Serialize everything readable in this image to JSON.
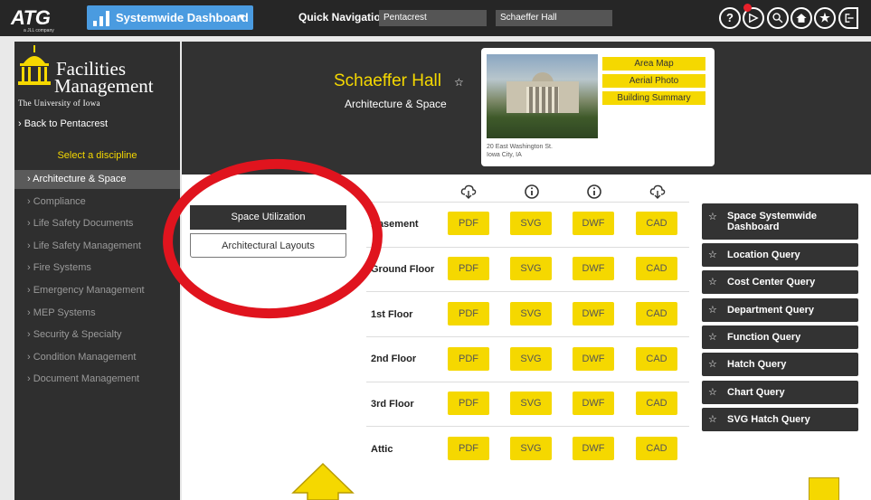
{
  "topbar": {
    "logo": "ATG",
    "logo_sub": "a JLL company",
    "dashboard_label": "Systemwide Dashboard",
    "quick_nav_label": "Quick Navigation",
    "quick_nav_campus": "Pentacrest",
    "quick_nav_building": "Schaeffer Hall",
    "icons": [
      "help-icon",
      "notification-icon",
      "search-icon",
      "home-icon",
      "star-icon",
      "logout-icon"
    ],
    "accent": "#4a9be0"
  },
  "sidebar": {
    "title_line1": "Facilities",
    "title_line2": "Management",
    "university": "The University of Iowa",
    "back_link": "› Back to Pentacrest",
    "select_label": "Select a discipline",
    "items": [
      {
        "label": "› Architecture & Space",
        "active": true
      },
      {
        "label": "› Compliance"
      },
      {
        "label": "› Life Safety Documents"
      },
      {
        "label": "› Life Safety Management"
      },
      {
        "label": "› Fire Systems"
      },
      {
        "label": "› Emergency Management"
      },
      {
        "label": "› MEP Systems"
      },
      {
        "label": "› Security & Specialty"
      },
      {
        "label": "› Condition Management"
      },
      {
        "label": "› Document Management"
      }
    ]
  },
  "header": {
    "building_name": "Schaeffer Hall",
    "discipline": "Architecture & Space",
    "address_line1": "20 East Washington St.",
    "address_line2": "Iowa City, IA",
    "buttons": [
      "Area Map",
      "Aerial Photo",
      "Building Summary"
    ],
    "accent": "#f5d800"
  },
  "tabs": [
    "Space Utilization",
    "Architectural Layouts"
  ],
  "column_icons": [
    "cloud-download-icon",
    "info-icon",
    "info-icon",
    "cloud-download-icon"
  ],
  "file_types": [
    "PDF",
    "SVG",
    "DWF",
    "CAD"
  ],
  "floors": [
    "Basement",
    "Ground Floor",
    "1st Floor",
    "2nd Floor",
    "3rd Floor",
    "Attic"
  ],
  "queries": [
    "Space Systemwide Dashboard",
    "Location Query",
    "Cost Center Query",
    "Department Query",
    "Function Query",
    "Hatch Query",
    "Chart Query",
    "SVG Hatch Query"
  ],
  "annotation_color": "#e0141e"
}
